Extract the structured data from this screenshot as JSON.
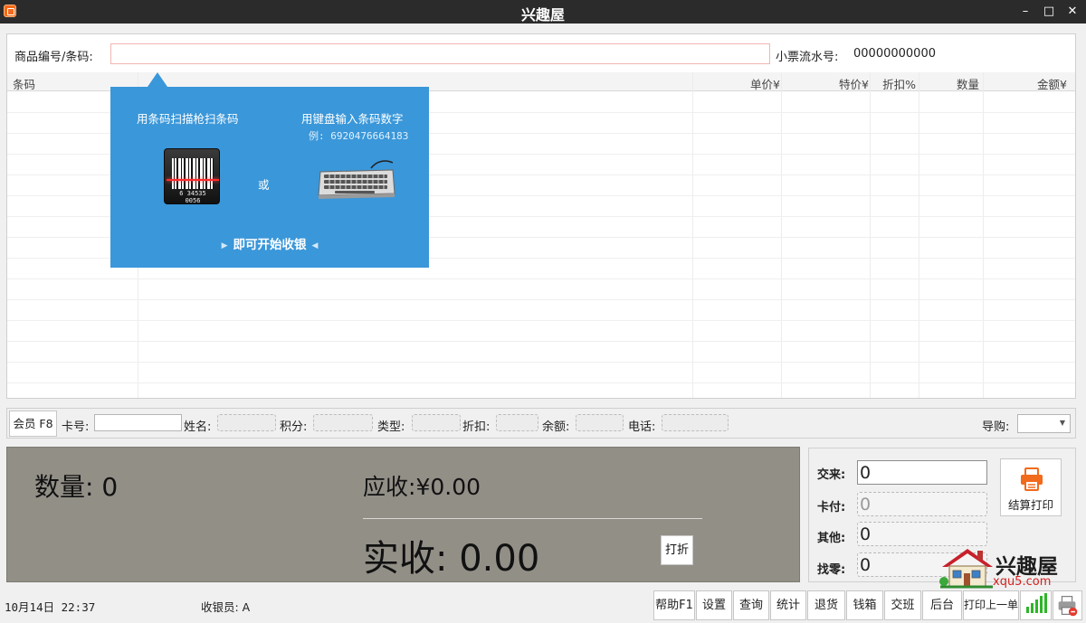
{
  "window": {
    "title": "兴趣屋",
    "minimize": "–",
    "maximize": "□",
    "close": "✕"
  },
  "search": {
    "label": "商品编号/条码:",
    "value": "",
    "placeholder": ""
  },
  "ticket": {
    "label": "小票流水号:",
    "value": "00000000000"
  },
  "grid": {
    "columns": [
      "条码",
      "单价¥",
      "特价¥",
      "折扣%",
      "数量",
      "金额¥"
    ]
  },
  "hint": {
    "scan_text": "用条码扫描枪扫条码",
    "keyboard_text": "用键盘输入条码数字",
    "example": "例: 6920476664183",
    "or": "或",
    "start": "即可开始收银",
    "barcode_digits": "6 34535 0056"
  },
  "member": {
    "button": "会员 F8",
    "card_label": "卡号:",
    "name_label": "姓名:",
    "points_label": "积分:",
    "type_label": "类型:",
    "discount_label": "折扣:",
    "balance_label": "余额:",
    "phone_label": "电话:",
    "guide_label": "导购:",
    "guide_value": ""
  },
  "totals": {
    "qty_label": "数量:",
    "qty_value": "0",
    "due_label": "应收:",
    "due_value": "¥0.00",
    "paid_label": "实收:",
    "paid_value": "0.00",
    "discount_button": "打折"
  },
  "payment": {
    "cash_label": "交来:",
    "cash_value": "0",
    "card_label": "卡付:",
    "card_value": "0",
    "other_label": "其他:",
    "other_value": "0",
    "change_label": "找零:",
    "change_value": "0",
    "checkout_button": "结算打印"
  },
  "logo": {
    "text": "兴趣屋",
    "url": "xqu5.com"
  },
  "status": {
    "datetime": "10月14日 22:37",
    "cashier": "收银员: A"
  },
  "footer_buttons": [
    "帮助F1",
    "设置",
    "查询",
    "统计",
    "退货",
    "钱箱",
    "交班",
    "后台",
    "打印上一单"
  ],
  "colors": {
    "titlebar": "#2b2b2b",
    "hint_blue": "#3a97d9",
    "totals_panel": "#928f87",
    "accent_orange": "#f26a1b",
    "logo_red": "#d42020"
  }
}
